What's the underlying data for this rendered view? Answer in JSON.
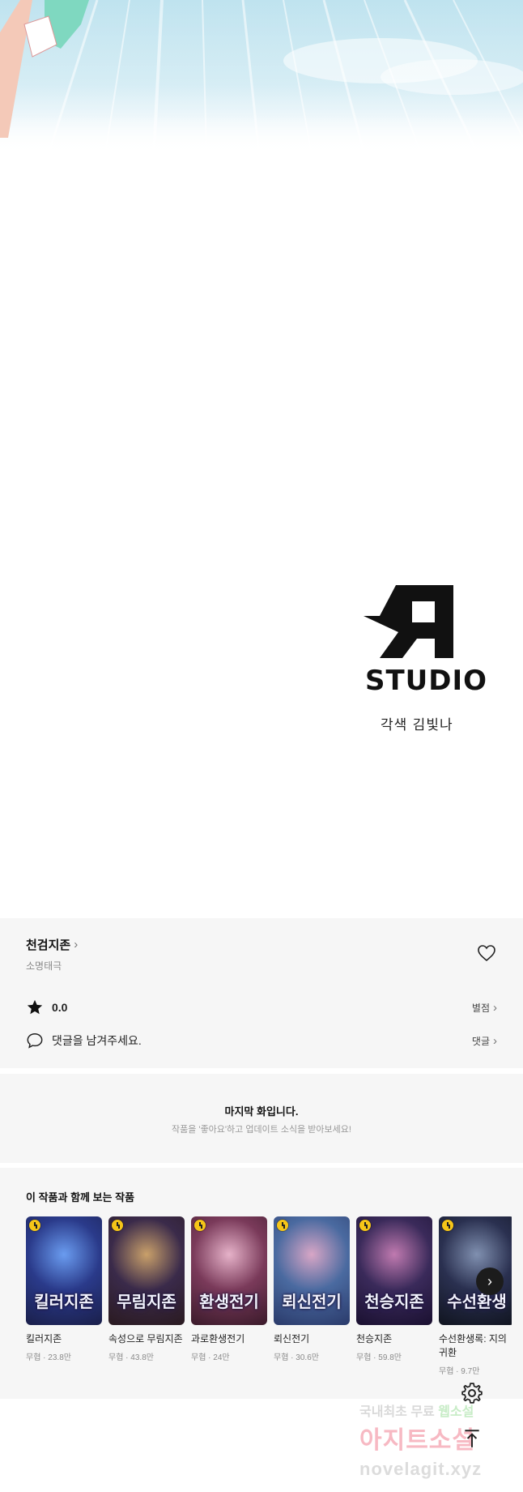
{
  "studio": {
    "logo_text": "STUDIO",
    "credit": "각색 김빛나"
  },
  "series": {
    "title": "천검지존",
    "author": "소명태극",
    "rating_value": "0.0",
    "rating_action": "별점",
    "comment_prompt": "댓글을 남겨주세요.",
    "comment_action": "댓글"
  },
  "last_episode": {
    "title": "마지막 화입니다.",
    "subtitle": "작품을 '좋아요'하고 업데이트 소식을 받아보세요!"
  },
  "recommendations": {
    "heading": "이 작품과 함께 보는 작품",
    "items": [
      {
        "title": "킬러지존",
        "meta": "무협 · 23.8만",
        "cover_text": "킬러지존",
        "colors": [
          "#2a3a8a",
          "#6a9cf0",
          "#1a1f4a"
        ]
      },
      {
        "title": "속성으로 무림지존",
        "meta": "무협 · 43.8만",
        "cover_text": "무림지존",
        "colors": [
          "#3a2a4a",
          "#c9a06a",
          "#2a1a20"
        ]
      },
      {
        "title": "과로환생전기",
        "meta": "무협 · 24만",
        "cover_text": "환생전기",
        "colors": [
          "#7a3a5a",
          "#e6b2c9",
          "#3a1a2a"
        ]
      },
      {
        "title": "뢰신전기",
        "meta": "무협 · 30.6만",
        "cover_text": "뢰신전기",
        "colors": [
          "#4a6aa0",
          "#d8a6c6",
          "#2a3a6a"
        ]
      },
      {
        "title": "천승지존",
        "meta": "무협 · 59.8만",
        "cover_text": "천승지존",
        "colors": [
          "#3a2a5a",
          "#c07ab0",
          "#1a1030"
        ]
      },
      {
        "title": "수선환생록: 지의 귀환",
        "meta": "무협 · 9.7만",
        "cover_text": "수선환생",
        "colors": [
          "#2a3050",
          "#8090b0",
          "#10141f"
        ]
      }
    ]
  },
  "watermark": {
    "line1": "국내최초 무료",
    "line1_highlight": "웹소설",
    "line2": "아지트소설",
    "line3": "novelagit.xyz"
  },
  "icons": {
    "heart": "heart-outline-icon",
    "star": "star-icon",
    "comment": "speech-bubble-icon",
    "settings": "gear-icon",
    "scroll_top": "arrow-up-to-top-icon",
    "next": "chevron-right-icon"
  }
}
